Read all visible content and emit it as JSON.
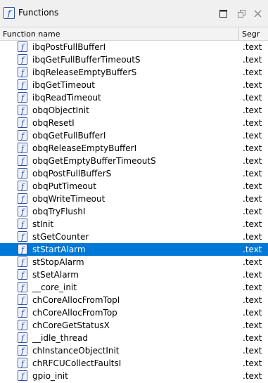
{
  "window": {
    "title": "Functions",
    "icon": "function-icon",
    "controls": [
      "maximize-icon",
      "restore-icon",
      "close-icon"
    ]
  },
  "table": {
    "columns": [
      "Function name",
      "Segr"
    ],
    "selected_index": 16,
    "rows": [
      {
        "name": "ibqPostFullBufferI",
        "segment": ".text"
      },
      {
        "name": "ibqGetFullBufferTimeoutS",
        "segment": ".text"
      },
      {
        "name": "ibqReleaseEmptyBufferS",
        "segment": ".text"
      },
      {
        "name": "ibqGetTimeout",
        "segment": ".text"
      },
      {
        "name": "ibqReadTimeout",
        "segment": ".text"
      },
      {
        "name": "obqObjectInit",
        "segment": ".text"
      },
      {
        "name": "obqResetI",
        "segment": ".text"
      },
      {
        "name": "obqGetFullBufferI",
        "segment": ".text"
      },
      {
        "name": "obqReleaseEmptyBufferI",
        "segment": ".text"
      },
      {
        "name": "obqGetEmptyBufferTimeoutS",
        "segment": ".text"
      },
      {
        "name": "obqPostFullBufferS",
        "segment": ".text"
      },
      {
        "name": "obqPutTimeout",
        "segment": ".text"
      },
      {
        "name": "obqWriteTimeout",
        "segment": ".text"
      },
      {
        "name": "obqTryFlushI",
        "segment": ".text"
      },
      {
        "name": "stInit",
        "segment": ".text"
      },
      {
        "name": "stGetCounter",
        "segment": ".text"
      },
      {
        "name": "stStartAlarm",
        "segment": ".text"
      },
      {
        "name": "stStopAlarm",
        "segment": ".text"
      },
      {
        "name": "stSetAlarm",
        "segment": ".text"
      },
      {
        "name": "__core_init",
        "segment": ".text"
      },
      {
        "name": "chCoreAllocFromTopI",
        "segment": ".text"
      },
      {
        "name": "chCoreAllocFromTop",
        "segment": ".text"
      },
      {
        "name": "chCoreGetStatusX",
        "segment": ".text"
      },
      {
        "name": "__idle_thread",
        "segment": ".text"
      },
      {
        "name": "chInstanceObjectInit",
        "segment": ".text"
      },
      {
        "name": "chRFCUCollectFaultsI",
        "segment": ".text"
      },
      {
        "name": "gpio_init",
        "segment": ".text"
      }
    ]
  },
  "colors": {
    "selection": "#0078d7",
    "icon_blue": "#2b4fa0",
    "header_bg": "#f3f3f3",
    "titlebar_bg": "#f0f0f0"
  }
}
